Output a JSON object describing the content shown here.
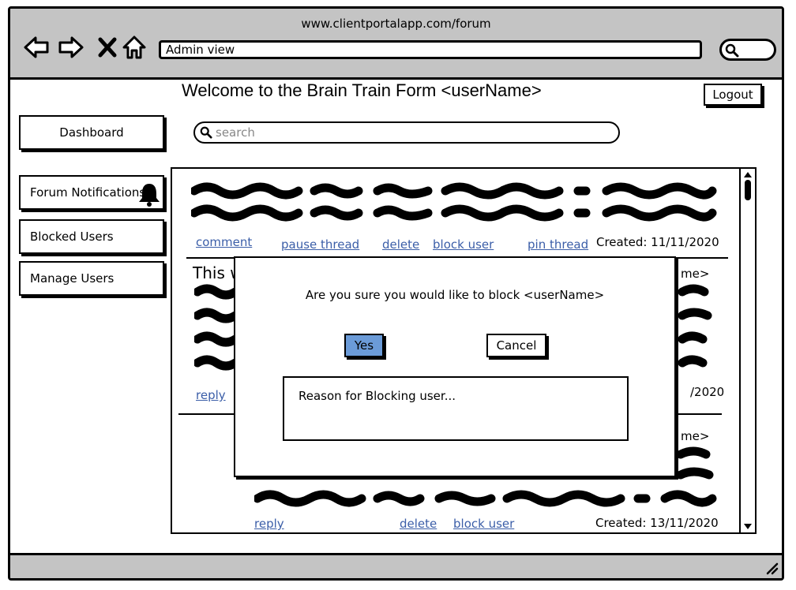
{
  "browser": {
    "url": "www.clientportalapp.com/forum",
    "address_value": "Admin view"
  },
  "icons": {
    "back": "arrow-left-icon",
    "forward": "arrow-right-icon",
    "stop": "close-icon",
    "home": "home-icon",
    "search": "search-icon",
    "bell": "bell-icon",
    "resize": "resize-grip-icon"
  },
  "header": {
    "title": "Welcome to the Brain Train Form <userName>",
    "logout_label": "Logout"
  },
  "sidebar": {
    "dashboard_label": "Dashboard",
    "items": [
      {
        "label": "Forum Notifications"
      },
      {
        "label": "Blocked Users"
      },
      {
        "label": "Manage Users"
      }
    ]
  },
  "search": {
    "placeholder": "search"
  },
  "posts": [
    {
      "actions": [
        "comment",
        "pause thread",
        "delete",
        "block user",
        "pin thread"
      ],
      "created": "Created: 11/11/2020"
    },
    {
      "text_start": "This w",
      "name_tail": "me>",
      "actions": [
        "reply"
      ],
      "created_tail": "/2020"
    },
    {
      "name_tail": "me>",
      "actions": [
        "reply",
        "delete",
        "block user"
      ],
      "created": "Created: 13/11/2020"
    }
  ],
  "modal": {
    "question": "Are you sure you would like to block <userName>",
    "yes_label": "Yes",
    "cancel_label": "Cancel",
    "reason_placeholder": "Reason for Blocking user..."
  },
  "colors": {
    "chrome": "#c4c4c4",
    "link": "#3b5ea8",
    "yes_button": "#6b9bd8"
  }
}
